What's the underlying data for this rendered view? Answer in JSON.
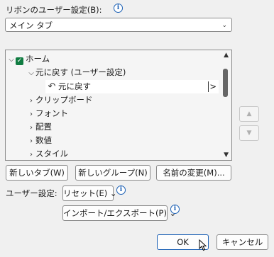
{
  "ribbon": {
    "label": "リボンのユーザー設定(B):",
    "select_value": "メイン タブ"
  },
  "tree": {
    "items": [
      {
        "label": "ホーム"
      },
      {
        "label": "元に戻す (ユーザー設定)"
      },
      {
        "label": "元に戻す"
      },
      {
        "label": "クリップボード"
      },
      {
        "label": "フォント"
      },
      {
        "label": "配置"
      },
      {
        "label": "数値"
      },
      {
        "label": "スタイル"
      }
    ],
    "submenu_arrow": ">"
  },
  "buttons": {
    "new_tab": "新しいタブ(W)",
    "new_group": "新しいグループ(N)",
    "rename": "名前の変更(M)...",
    "reset": "リセット(E) ⌄",
    "import_export": "インポート/エクスポート(P) ⌄",
    "ok": "OK",
    "cancel": "キャンセル"
  },
  "user_settings": {
    "label": "ユーザー設定:"
  },
  "icons": {
    "info": "i",
    "chevron": "⌄",
    "caret_down": "⌵",
    "caret_right": "›",
    "check": "✓",
    "undo": "↶",
    "scroll_up": "▲",
    "scroll_down": "▼",
    "move_up": "▲",
    "move_down": "▼"
  }
}
